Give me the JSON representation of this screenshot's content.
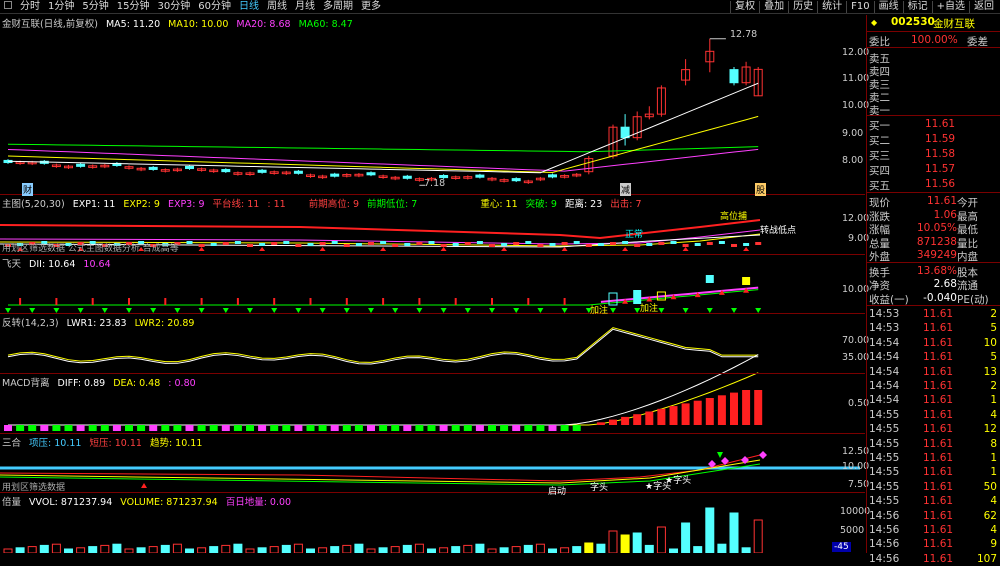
{
  "topbar": {
    "tabs": [
      "分时",
      "1分钟",
      "5分钟",
      "15分钟",
      "30分钟",
      "60分钟",
      "日线",
      "周线",
      "月线",
      "多周期",
      "更多"
    ],
    "active_tab": "日线",
    "buttons": [
      "复权",
      "叠加",
      "历史",
      "统计",
      "F10",
      "画线",
      "标记",
      "+自选",
      "返回"
    ]
  },
  "main": {
    "title": "金财互联(日线,前复权)",
    "ma5": "MA5: 11.20",
    "ma10": "MA10: 10.00",
    "ma20": "MA20: 8.68",
    "ma60": "MA60: 8.47",
    "high_label": "12.78",
    "low_label": "7.18",
    "y_labels": [
      "12.00",
      "11.00",
      "10.00",
      "9.00",
      "8.00"
    ],
    "marker_cai": "财",
    "marker_jian": "减",
    "marker_gui": "股"
  },
  "p2": {
    "title": "主图(5,20,30)",
    "exp1": "EXP1: 11",
    "exp2": "EXP2: 9",
    "exp3": "EXP3: 9",
    "pingshi": "平台线: 11",
    "blank": ": 11",
    "prev_high": "前期高位: 9",
    "prev_low": "前期低位: 7",
    "zhongxin": "重心: 11",
    "tupo": "突破: 9",
    "juli": "距离: 23",
    "chuji": "出击: 7",
    "y_labels": [
      "12.00",
      "9.00"
    ],
    "label_huaquan": "用划区筛选数据",
    "label_gongshi": "公式主图数据分析",
    "label_gaolun": "合成高等",
    "label_yangui": "正常",
    "label_zhuanzhan": "转战低点",
    "label_chaoshang": "高位捕"
  },
  "p3": {
    "title": "飞天",
    "dii": "DII: 10.64",
    "val": "10.64",
    "y_label": "10.00",
    "t1": "加注",
    "t2": "加注"
  },
  "p4": {
    "title": "反转(14,2,3)",
    "lwr1": "LWR1: 23.83",
    "lwr2": "LWR2: 20.89",
    "y_labels": [
      "70.00",
      "35.00"
    ]
  },
  "p5": {
    "title": "MACD背离",
    "diff": "DIFF: 0.89",
    "dea": "DEA: 0.48",
    "macd": ": 0.80",
    "y_label": "0.50"
  },
  "p6": {
    "title": "三合",
    "xiangya": "项压: 10.11",
    "duanya": "短压: 10.11",
    "qushi": "趋势: 10.11",
    "y_labels": [
      "12.50",
      "10.00",
      "7.50"
    ],
    "l1": "用划区筛选数据",
    "l2": "启动",
    "l3": "字头",
    "l4": "★字头",
    "l5": "★字头"
  },
  "p7": {
    "title": "倍量",
    "vvol": "VVOL: 871237.94",
    "volume": "VOLUME: 871237.94",
    "baili": "百日地量: 0.00",
    "y_label": "10000",
    "y_label2": "5000",
    "tick": "-45"
  },
  "quote": {
    "code": "002530",
    "name": "金财互联",
    "weibi_label": "委比",
    "weibi_val": "100.00%",
    "weicha_label": "委差",
    "sells": [
      {
        "l": "卖五"
      },
      {
        "l": "卖四"
      },
      {
        "l": "卖三"
      },
      {
        "l": "卖二"
      },
      {
        "l": "卖一"
      }
    ],
    "buys": [
      {
        "l": "买一",
        "p": "11.61"
      },
      {
        "l": "买二",
        "p": "11.59"
      },
      {
        "l": "买三",
        "p": "11.58"
      },
      {
        "l": "买四",
        "p": "11.57"
      },
      {
        "l": "买五",
        "p": "11.56"
      }
    ],
    "stats": [
      {
        "a": "现价",
        "v": "11.61",
        "b": "今开"
      },
      {
        "a": "涨跌",
        "v": "1.06",
        "b": "最高"
      },
      {
        "a": "涨幅",
        "v": "10.05%",
        "b": "最低"
      },
      {
        "a": "总量",
        "v": "871238",
        "b": "量比"
      },
      {
        "a": "外盘",
        "v": "349249",
        "b": "内盘"
      },
      {
        "a": "换手",
        "v": "13.68%",
        "b": "股本"
      },
      {
        "a": "净资",
        "v": "2.68",
        "b": "流通"
      },
      {
        "a": "收益(一)",
        "v": "-0.040",
        "b": "PE(动)"
      }
    ]
  },
  "ticks": [
    [
      "14:53",
      "11.61",
      "2"
    ],
    [
      "14:53",
      "11.61",
      "5"
    ],
    [
      "14:54",
      "11.61",
      "10"
    ],
    [
      "14:54",
      "11.61",
      "5"
    ],
    [
      "14:54",
      "11.61",
      "13"
    ],
    [
      "14:54",
      "11.61",
      "2"
    ],
    [
      "14:54",
      "11.61",
      "1"
    ],
    [
      "14:55",
      "11.61",
      "4"
    ],
    [
      "14:55",
      "11.61",
      "12"
    ],
    [
      "14:55",
      "11.61",
      "8"
    ],
    [
      "14:55",
      "11.61",
      "1"
    ],
    [
      "14:55",
      "11.61",
      "1"
    ],
    [
      "14:55",
      "11.61",
      "50"
    ],
    [
      "14:55",
      "11.61",
      "4"
    ],
    [
      "14:56",
      "11.61",
      "62"
    ],
    [
      "14:56",
      "11.61",
      "4"
    ],
    [
      "14:56",
      "11.61",
      "9"
    ],
    [
      "14:56",
      "11.61",
      "107"
    ]
  ],
  "colors": {
    "up": "#ff3232",
    "down": "#54ffff",
    "yellow": "#ffff00",
    "pink": "#ff40ff",
    "green": "#00ff00",
    "white": "#ffffff",
    "darkred": "#7a0000"
  }
}
